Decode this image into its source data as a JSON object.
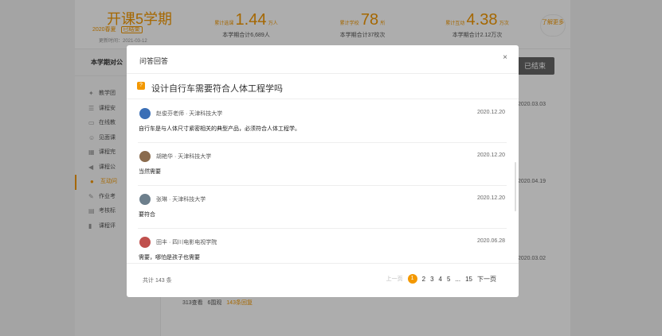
{
  "header": {
    "term_title": "开课5学期",
    "term_season": "2020春夏",
    "term_status": "已结束",
    "updated": "更新时间：2021-03-12",
    "stats": [
      {
        "label": "累计选课",
        "value": "1.44",
        "unit": "万人",
        "sub": "本学期合计6,689人"
      },
      {
        "label": "累计学校",
        "value": "78",
        "unit": "所",
        "sub": "本学期合计37校次"
      },
      {
        "label": "累计互动",
        "value": "4.38",
        "unit": "万次",
        "sub": "本学期合计2.12万次"
      }
    ],
    "more_label": "了解更多"
  },
  "sidebar": {
    "title": "本学期对公",
    "items": [
      {
        "label": "教学团",
        "icon": "graduation-icon"
      },
      {
        "label": "课程安",
        "icon": "list-icon"
      },
      {
        "label": "在线教",
        "icon": "monitor-icon"
      },
      {
        "label": "见面课",
        "icon": "people-icon"
      },
      {
        "label": "课程完",
        "icon": "grid-icon"
      },
      {
        "label": "课程公",
        "icon": "megaphone-icon"
      },
      {
        "label": "互动问",
        "icon": "chat-icon",
        "active": true
      },
      {
        "label": "作业考",
        "icon": "pencil-icon"
      },
      {
        "label": "考核标",
        "icon": "calendar-icon"
      },
      {
        "label": "课程评",
        "icon": "bar-chart-icon"
      }
    ]
  },
  "background": {
    "ended_button": "已结束",
    "dates": [
      "2020.03.03",
      "2020.04.19",
      "2020.03.02"
    ],
    "foot_views": "313查看",
    "foot_follow": "6围观",
    "foot_replies": "143条回复"
  },
  "modal": {
    "title": "问答回答",
    "close_label": "×",
    "question": "设计自行车需要符合人体工程学吗",
    "answers": [
      {
        "author": "赵俊芬老师 · 天津科技大学",
        "date": "2020.12.20",
        "text": "自行车是与人体尺寸紧密相关的典型产品，必须符合人体工程学。",
        "avatar_color": "#3b6fb6"
      },
      {
        "author": "胡艳华 · 天津科技大学",
        "date": "2020.12.20",
        "text": "当然需要",
        "avatar_color": "#8a6b4d"
      },
      {
        "author": "张琳 · 天津科技大学",
        "date": "2020.12.20",
        "text": "要符合",
        "avatar_color": "#6d7f8c"
      },
      {
        "author": "田丰 · 四川电影电视学院",
        "date": "2020.06.28",
        "text": "需要，哪怕是孩子也需要",
        "avatar_color": "#c0504d"
      }
    ],
    "total": "共计 143 条",
    "pager": {
      "prev": "上一页",
      "pages": [
        "1",
        "2",
        "3",
        "4",
        "5",
        "...",
        "15"
      ],
      "current": "1",
      "next": "下一页"
    }
  },
  "colors": {
    "accent": "#f39800",
    "overlay": "rgba(0,0,0,0.32)"
  }
}
